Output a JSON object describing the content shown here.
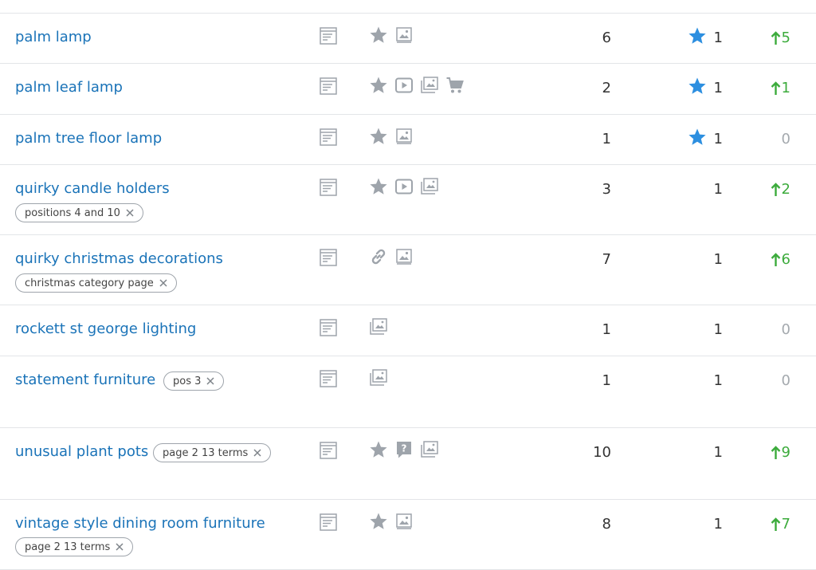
{
  "rows": [
    {
      "keyword": "palm lamp",
      "tag": "",
      "volume": "6",
      "position": "1",
      "diff": "5",
      "trend": "up",
      "starred": true,
      "features": [
        "star-icon",
        "image-icon"
      ]
    },
    {
      "keyword": "palm leaf lamp",
      "tag": "",
      "volume": "2",
      "position": "1",
      "diff": "1",
      "trend": "up",
      "starred": true,
      "features": [
        "star-icon",
        "video-icon",
        "images-icon",
        "cart-icon"
      ]
    },
    {
      "keyword": "palm tree floor lamp",
      "tag": "",
      "volume": "1",
      "position": "1",
      "diff": "0",
      "trend": "zero",
      "starred": true,
      "features": [
        "star-icon",
        "image-icon"
      ]
    },
    {
      "keyword": "quirky candle holders",
      "tag": "positions 4 and 10",
      "volume": "3",
      "position": "1",
      "diff": "2",
      "trend": "up",
      "starred": false,
      "features": [
        "star-icon",
        "video-icon",
        "images-icon"
      ]
    },
    {
      "keyword": "quirky christmas decorations",
      "tag": "christmas category page",
      "volume": "7",
      "position": "1",
      "diff": "6",
      "trend": "up",
      "starred": false,
      "features": [
        "link-icon",
        "image-icon"
      ]
    },
    {
      "keyword": "rockett st george lighting",
      "tag": "",
      "volume": "1",
      "position": "1",
      "diff": "0",
      "trend": "zero",
      "starred": false,
      "features": [
        "images-icon"
      ]
    },
    {
      "keyword": "statement furniture",
      "tag": "pos 3",
      "volume": "1",
      "position": "1",
      "diff": "0",
      "trend": "zero",
      "starred": false,
      "features": [
        "images-icon"
      ]
    },
    {
      "keyword": "unusual plant pots",
      "tag": "page 2 13 terms",
      "volume": "10",
      "position": "1",
      "diff": "9",
      "trend": "up",
      "starred": false,
      "features": [
        "star-icon",
        "question-icon",
        "images-icon"
      ]
    },
    {
      "keyword": "vintage style dining room furniture",
      "tag": "page 2 13 terms",
      "volume": "8",
      "position": "1",
      "diff": "7",
      "trend": "up",
      "starred": false,
      "features": [
        "star-icon",
        "image-icon"
      ]
    }
  ],
  "colors": {
    "link": "#1a73b8",
    "up": "#3cab3c",
    "zero": "#a4a9ae",
    "star_blue": "#2d8fe0",
    "icon_gray": "#9ea4ab"
  }
}
